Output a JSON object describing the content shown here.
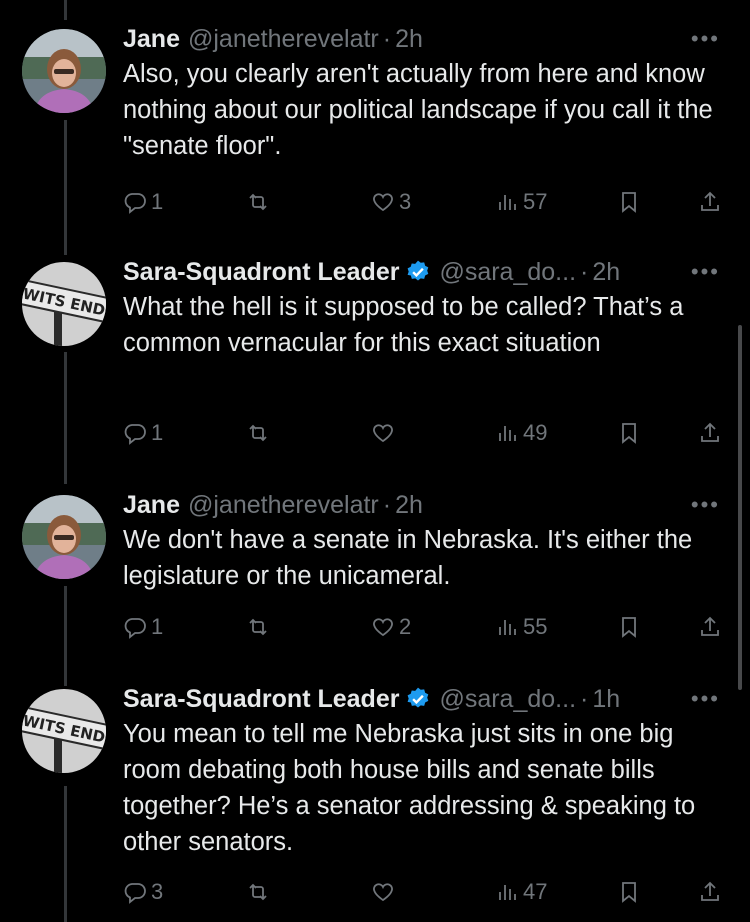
{
  "tweets": [
    {
      "author": "Jane",
      "handle": "@janetherevelatr",
      "time": "2h",
      "verified": false,
      "text": "Also, you clearly aren't actually from here and know nothing about our political landscape if you call it the \"senate floor\".",
      "replies": "1",
      "retweets": "",
      "likes": "3",
      "views": "57"
    },
    {
      "author": "Sara-Squadront Leader",
      "handle": "@sara_do...",
      "time": "2h",
      "verified": true,
      "text": "What the hell is it supposed to be called? That’s a common vernacular for this exact situation",
      "replies": "1",
      "retweets": "",
      "likes": "",
      "views": "49"
    },
    {
      "author": "Jane",
      "handle": "@janetherevelatr",
      "time": "2h",
      "verified": false,
      "text": "We don't have a senate in Nebraska. It's either the legislature or the unicameral.",
      "replies": "1",
      "retweets": "",
      "likes": "2",
      "views": "55"
    },
    {
      "author": "Sara-Squadront Leader",
      "handle": "@sara_do...",
      "time": "1h",
      "verified": true,
      "text": "You mean to tell me Nebraska just sits in one big room debating both house bills and senate bills together? He’s a senator addressing & speaking to other senators.",
      "replies": "3",
      "retweets": "",
      "likes": "",
      "views": "47"
    }
  ],
  "common": {
    "dot": "·",
    "more": "•••",
    "avatar_sign_text": "WITS END"
  },
  "colors": {
    "verified": "#1d9bf0",
    "muted": "#71767b",
    "background": "#000000"
  }
}
